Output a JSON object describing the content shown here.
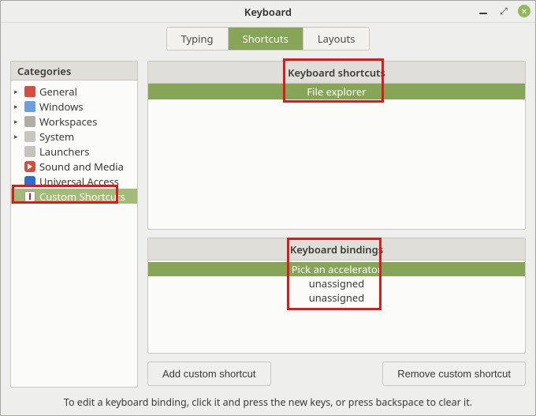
{
  "window": {
    "title": "Keyboard"
  },
  "tabs": [
    {
      "label": "Typing",
      "active": false
    },
    {
      "label": "Shortcuts",
      "active": true
    },
    {
      "label": "Layouts",
      "active": false
    }
  ],
  "categories": {
    "header": "Categories",
    "items": [
      {
        "label": "General",
        "icon": "general",
        "expandable": true
      },
      {
        "label": "Windows",
        "icon": "windows",
        "expandable": true
      },
      {
        "label": "Workspaces",
        "icon": "workspaces",
        "expandable": true
      },
      {
        "label": "System",
        "icon": "system",
        "expandable": true
      },
      {
        "label": "Launchers",
        "icon": "launchers",
        "expandable": false
      },
      {
        "label": "Sound and Media",
        "icon": "sound",
        "expandable": false
      },
      {
        "label": "Universal Access",
        "icon": "universal",
        "expandable": false
      },
      {
        "label": "Custom Shortcuts",
        "icon": "custom",
        "expandable": false,
        "selected": true
      }
    ]
  },
  "shortcuts": {
    "header": "Keyboard shortcuts",
    "rows": [
      {
        "name": "File explorer",
        "selected": true
      }
    ]
  },
  "bindings": {
    "header": "Keyboard bindings",
    "rows": [
      {
        "value": "Pick an accelerator",
        "active": true
      },
      {
        "value": "unassigned",
        "active": false
      },
      {
        "value": "unassigned",
        "active": false
      }
    ]
  },
  "buttons": {
    "add": "Add custom shortcut",
    "remove": "Remove custom shortcut"
  },
  "hint": "To edit a keyboard binding, click it and press the new keys, or press backspace to clear it."
}
